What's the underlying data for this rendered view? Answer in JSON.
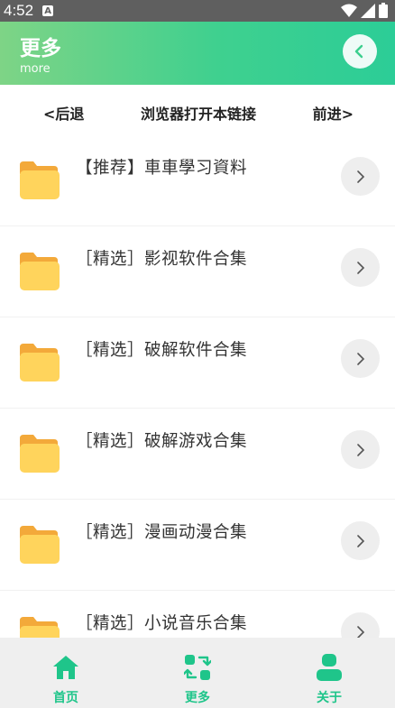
{
  "status": {
    "time": "4:52",
    "notif": "A"
  },
  "header": {
    "title": "更多",
    "subtitle": "more"
  },
  "nav": {
    "back": "<后退",
    "open": "浏览器打开本链接",
    "forward": "前进>"
  },
  "items": [
    {
      "label": "【推荐】車車學习資料"
    },
    {
      "label": "［精选］影视软件合集"
    },
    {
      "label": "［精选］破解软件合集"
    },
    {
      "label": "［精选］破解游戏合集"
    },
    {
      "label": "［精选］漫画动漫合集"
    },
    {
      "label": "［精选］小说音乐合集"
    }
  ],
  "bottom_nav": [
    {
      "label": "首页",
      "icon": "home-icon"
    },
    {
      "label": "更多",
      "icon": "swap-grid-icon"
    },
    {
      "label": "关于",
      "icon": "user-icon"
    }
  ],
  "colors": {
    "accent": "#1fc58a",
    "header_start": "#7ed486",
    "header_end": "#2ccd97",
    "folder": "#ffd45c"
  }
}
